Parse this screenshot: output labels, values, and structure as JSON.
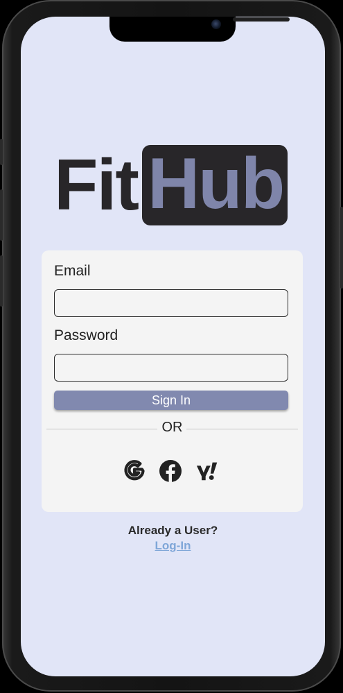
{
  "app": {
    "logo_part1": "Fit",
    "logo_part2": "Hub",
    "background_color": "#e1e5f7",
    "accent_color": "#8189af"
  },
  "form": {
    "email_label": "Email",
    "email_value": "",
    "password_label": "Password",
    "password_value": "",
    "signin_label": "Sign In",
    "divider_text": "OR"
  },
  "social": {
    "providers": [
      {
        "name": "Google",
        "icon": "google-icon"
      },
      {
        "name": "Facebook",
        "icon": "facebook-icon"
      },
      {
        "name": "Yahoo",
        "icon": "yahoo-icon"
      }
    ]
  },
  "footer": {
    "prompt": "Already a User?",
    "link": "Log-In"
  }
}
